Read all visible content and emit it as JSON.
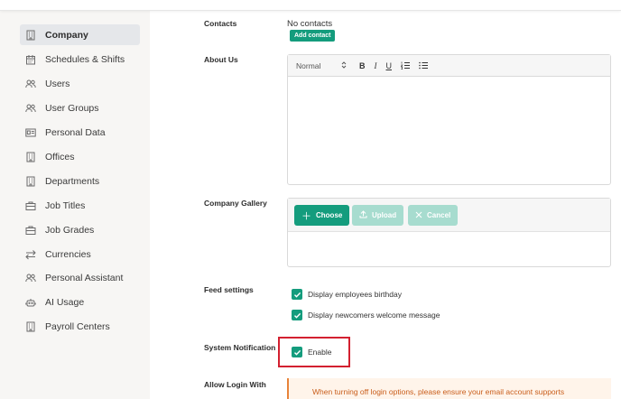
{
  "sidebar": {
    "items": [
      {
        "label": "Company",
        "icon": "building-icon",
        "active": true
      },
      {
        "label": "Schedules & Shifts",
        "icon": "calendar-icon"
      },
      {
        "label": "Users",
        "icon": "users-icon"
      },
      {
        "label": "User Groups",
        "icon": "users-icon"
      },
      {
        "label": "Personal Data",
        "icon": "id-card-icon"
      },
      {
        "label": "Offices",
        "icon": "building-icon"
      },
      {
        "label": "Departments",
        "icon": "building-icon"
      },
      {
        "label": "Job Titles",
        "icon": "briefcase-icon"
      },
      {
        "label": "Job Grades",
        "icon": "briefcase-icon"
      },
      {
        "label": "Currencies",
        "icon": "swap-icon"
      },
      {
        "label": "Personal Assistant",
        "icon": "users-icon"
      },
      {
        "label": "AI Usage",
        "icon": "robot-icon"
      },
      {
        "label": "Payroll Centers",
        "icon": "building-icon"
      }
    ]
  },
  "form": {
    "contacts": {
      "label": "Contacts",
      "value": "No contacts",
      "add_label": "Add contact"
    },
    "about": {
      "label": "About Us",
      "header_select": "Normal",
      "bold": "B",
      "italic": "I",
      "underline": "U"
    },
    "gallery": {
      "label": "Company Gallery",
      "choose": "Choose",
      "upload": "Upload",
      "cancel": "Cancel"
    },
    "feed": {
      "label": "Feed settings",
      "options": [
        {
          "label": "Display employees birthday",
          "checked": true
        },
        {
          "label": "Display newcomers welcome message",
          "checked": true
        }
      ]
    },
    "system_notification": {
      "label": "System Notification",
      "option_label": "Enable",
      "checked": true
    },
    "login": {
      "label": "Allow Login With",
      "warning": "When turning off login options, please ensure your email account supports"
    }
  },
  "colors": {
    "accent": "#149c7d",
    "highlight": "#d32030",
    "warning": "#c95e1c"
  }
}
